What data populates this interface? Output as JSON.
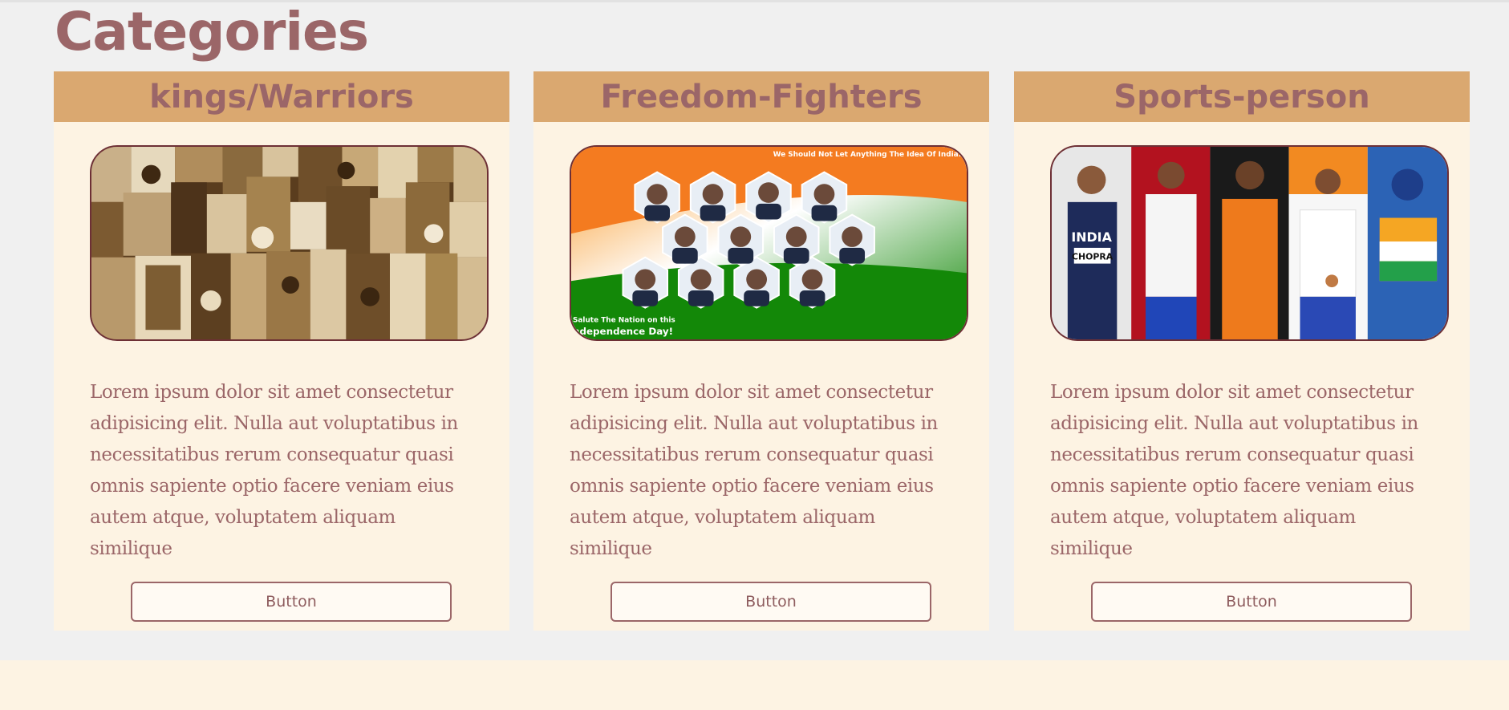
{
  "page": {
    "title": "Categories",
    "colors": {
      "title": "#9b6668",
      "card_header": "#daa870",
      "card_body": "#fdf3e3",
      "page_background": "#f0f0f0",
      "button_border": "#9b6668"
    }
  },
  "cards": [
    {
      "title": "kings/Warriors",
      "image": "sepia-portrait-collage",
      "text": "Lorem ipsum dolor sit amet consectetur adipisicing elit. Nulla aut voluptatibus in necessitatibus rerum consequatur quasi omnis sapiente optio facere veniam eius autem atque, voluptatem aliquam similique",
      "button": "Button"
    },
    {
      "title": "Freedom-Fighters",
      "image": "freedom-fighters-hexagon-collage",
      "image_text_top": "We Should Not Let Anything The Idea Of India.",
      "image_text_bottom_1": "Salute The Nation on this",
      "image_text_bottom_2": "ndependence Day!",
      "text": "Lorem ipsum dolor sit amet consectetur adipisicing elit. Nulla aut voluptatibus in necessitatibus rerum consequatur quasi omnis sapiente optio facere veniam eius autem atque, voluptatem aliquam similique",
      "button": "Button"
    },
    {
      "title": "Sports-person",
      "image": "athletes-collage",
      "image_text_jersey": "INDIA",
      "image_text_bib": "CHOPRA",
      "text": "Lorem ipsum dolor sit amet consectetur adipisicing elit. Nulla aut voluptatibus in necessitatibus rerum consequatur quasi omnis sapiente optio facere veniam eius autem atque, voluptatem aliquam similique",
      "button": "Button"
    }
  ]
}
